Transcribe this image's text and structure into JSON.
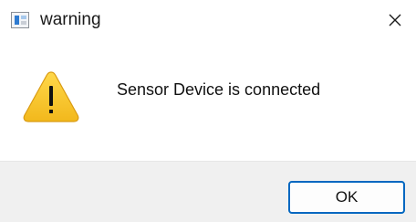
{
  "window": {
    "title": "warning",
    "app_icon": "application-icon",
    "close_icon": "close-icon"
  },
  "dialog": {
    "icon": "warning-icon",
    "message": "Sensor Device is connected"
  },
  "buttons": {
    "ok_label": "OK"
  },
  "colors": {
    "warning_fill": "#f5c02a",
    "accent_border": "#0067c0",
    "footer_bg": "#f0f0f0"
  }
}
